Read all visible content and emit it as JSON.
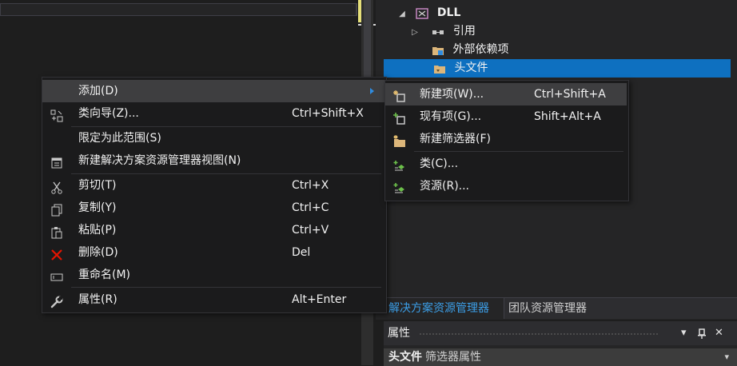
{
  "tree": {
    "items": [
      {
        "name": "DLL",
        "bold": true
      },
      {
        "name": "引用"
      },
      {
        "name": "外部依赖项"
      },
      {
        "name": "头文件",
        "selected": true
      }
    ]
  },
  "context_menu": {
    "items": [
      {
        "label": "添加(D)",
        "shortcut": ""
      },
      {
        "label": "类向导(Z)...",
        "shortcut": "Ctrl+Shift+X"
      },
      {
        "label": "限定为此范围(S)",
        "shortcut": ""
      },
      {
        "label": "新建解决方案资源管理器视图(N)",
        "shortcut": ""
      },
      {
        "label": "剪切(T)",
        "shortcut": "Ctrl+X"
      },
      {
        "label": "复制(Y)",
        "shortcut": "Ctrl+C"
      },
      {
        "label": "粘贴(P)",
        "shortcut": "Ctrl+V"
      },
      {
        "label": "删除(D)",
        "shortcut": "Del"
      },
      {
        "label": "重命名(M)",
        "shortcut": ""
      },
      {
        "label": "属性(R)",
        "shortcut": "Alt+Enter"
      }
    ]
  },
  "submenu": {
    "items": [
      {
        "label": "新建项(W)...",
        "shortcut": "Ctrl+Shift+A"
      },
      {
        "label": "现有项(G)...",
        "shortcut": "Shift+Alt+A"
      },
      {
        "label": "新建筛选器(F)",
        "shortcut": ""
      },
      {
        "label": "类(C)...",
        "shortcut": ""
      },
      {
        "label": "资源(R)...",
        "shortcut": ""
      }
    ]
  },
  "tabs": [
    {
      "label": "解决方案资源管理器",
      "active": true
    },
    {
      "label": "团队资源管理器",
      "active": false
    }
  ],
  "properties": {
    "title": "属性",
    "selected_name": "头文件",
    "selected_type": "筛选器属性",
    "dropdown_glyph": "▾",
    "pin_glyph": "📌",
    "close_glyph": "✕"
  },
  "colors": {
    "accent": "#0e70c0",
    "tab_active_text": "#3c9fe8",
    "menu_bg": "#1b1b1c",
    "highlight": "#3e3e40"
  }
}
